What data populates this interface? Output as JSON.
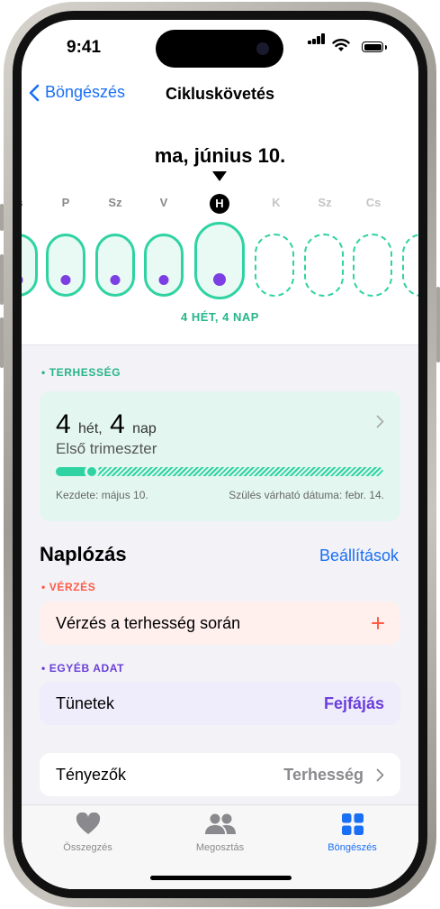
{
  "status": {
    "time": "9:41"
  },
  "nav": {
    "back_label": "Böngészés",
    "title": "Cikluskövetés"
  },
  "date_header": "ma, június 10.",
  "days": [
    {
      "label": "s",
      "state": "past"
    },
    {
      "label": "P",
      "state": "past"
    },
    {
      "label": "Sz",
      "state": "past"
    },
    {
      "label": "V",
      "state": "past"
    },
    {
      "label": "H",
      "state": "today"
    },
    {
      "label": "K",
      "state": "future"
    },
    {
      "label": "Sz",
      "state": "future"
    },
    {
      "label": "Cs",
      "state": "future"
    }
  ],
  "week_label": "4 HÉT, 4 NAP",
  "pregnancy": {
    "section_label": "• TERHESSÉG",
    "weeks": "4",
    "weeks_unit": "hét,",
    "days": "4",
    "days_unit": "nap",
    "trimester": "Első trimeszter",
    "start": "Kezdete: május 10.",
    "due": "Szülés várható dátuma: febr. 14.",
    "progress": 0.11
  },
  "logging": {
    "title": "Naplózás",
    "settings_label": "Beállítások",
    "bleeding_label": "• VÉRZÉS",
    "bleeding_row": "Vérzés a terhesség során",
    "other_label": "• EGYÉB ADAT",
    "symptoms_row": "Tünetek",
    "symptoms_value": "Fejfájás",
    "factors_row": "Tényezők",
    "factors_value": "Terhesség"
  },
  "tabs": [
    {
      "label": "Összegzés",
      "active": false
    },
    {
      "label": "Megosztás",
      "active": false
    },
    {
      "label": "Böngészés",
      "active": true
    }
  ],
  "colors": {
    "accent": "#1a6ff5",
    "pregnancy_green": "#2fd3a2",
    "bleeding_red": "#ff5a45",
    "other_purple": "#7b3fe4"
  }
}
